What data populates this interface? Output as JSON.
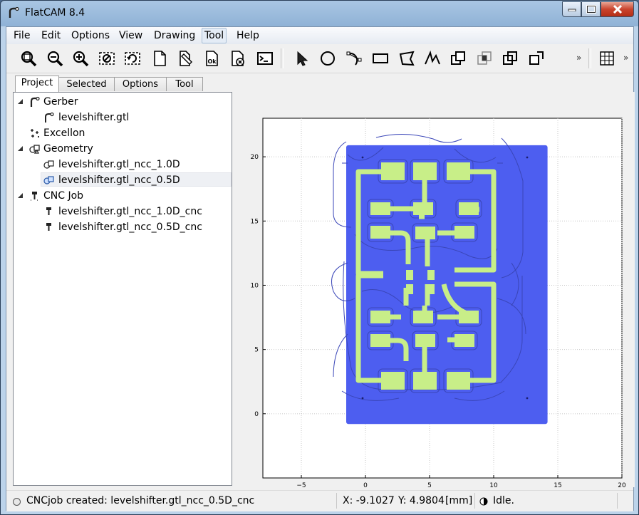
{
  "window": {
    "title": "FlatCAM 8.4"
  },
  "menu": [
    "File",
    "Edit",
    "Options",
    "View",
    "Drawing",
    "Tool",
    "Help"
  ],
  "menu_active": "Tool",
  "toolbar": {
    "icons": [
      "zoom-fit-icon",
      "zoom-out-icon",
      "zoom-in-icon",
      "clear-plot-icon",
      "replot-icon",
      "new-project-icon",
      "open-file-icon",
      "ok-icon",
      "delete-icon",
      "shell-icon",
      "select-arrow-icon",
      "circle-icon",
      "arc-icon",
      "rectangle-icon",
      "polygon-icon",
      "path-icon",
      "union-icon",
      "intersection-icon",
      "subtract-icon",
      "cut-icon",
      "grid-icon"
    ],
    "overflow_label": "»"
  },
  "tabs": [
    "Project",
    "Selected",
    "Options",
    "Tool"
  ],
  "active_tab": "Project",
  "tree": {
    "groups": [
      {
        "label": "Gerber",
        "icon": "gerber-icon",
        "expanded": true,
        "children": [
          "levelshifter.gtl"
        ]
      },
      {
        "label": "Excellon",
        "icon": "excellon-icon",
        "expanded": false,
        "children": []
      },
      {
        "label": "Geometry",
        "icon": "geometry-icon",
        "expanded": true,
        "children": [
          "levelshifter.gtl_ncc_1.0D",
          "levelshifter.gtl_ncc_0.5D"
        ]
      },
      {
        "label": "CNC Job",
        "icon": "cnc-icon",
        "expanded": true,
        "children": [
          "levelshifter.gtl_ncc_1.0D_cnc",
          "levelshifter.gtl_ncc_0.5D_cnc"
        ]
      }
    ],
    "selected": "levelshifter.gtl_ncc_0.5D"
  },
  "chart_data": {
    "type": "scatter",
    "title": "",
    "xlabel": "",
    "ylabel": "",
    "xlim": [
      -8,
      20
    ],
    "ylim": [
      -5,
      23
    ],
    "x_ticks": [
      "-5",
      "0",
      "5",
      "10",
      "15",
      "20"
    ],
    "y_ticks": [
      "0",
      "5",
      "10",
      "15",
      "20"
    ],
    "grid": true,
    "board_extent": {
      "x": [
        -1.5,
        14.2
      ],
      "y": [
        -0.8,
        20.9
      ]
    },
    "colors": {
      "board": "#4d5ef0",
      "copper": "#c8ee88",
      "trace_outline": "#3a46b8"
    }
  },
  "status": {
    "message": "CNCjob created: levelshifter.gtl_ncc_0.5D_cnc",
    "x": "X: -9.1027",
    "y": "Y: 4.9804",
    "unit": "[mm]",
    "state": "Idle."
  }
}
